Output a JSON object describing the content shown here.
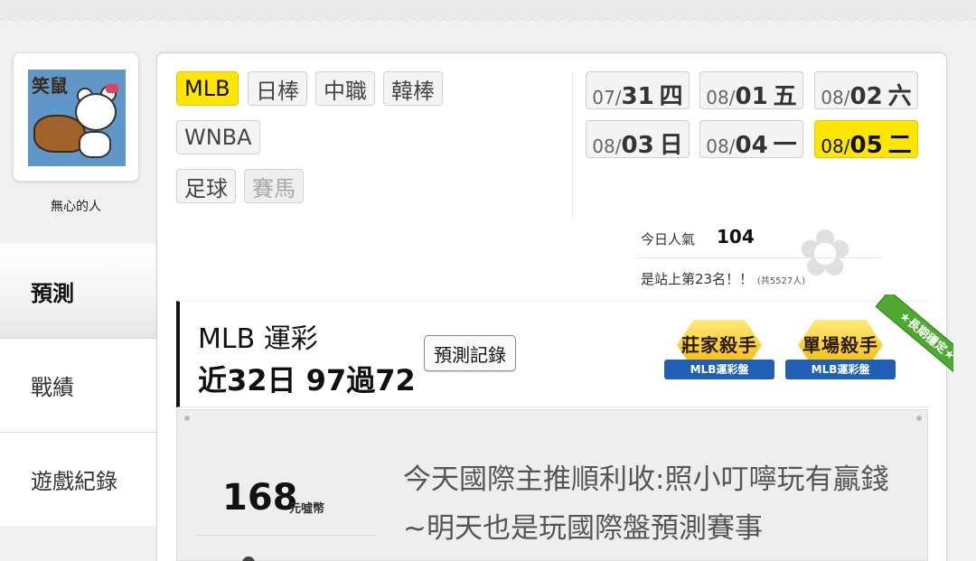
{
  "profile": {
    "avatar_caption": "笑鼠",
    "username": "無心的人"
  },
  "sidebar": {
    "items": [
      {
        "label": "預測",
        "active": true
      },
      {
        "label": "戰績",
        "active": false
      },
      {
        "label": "遊戲紀錄",
        "active": false
      }
    ]
  },
  "sports": [
    {
      "label": "MLB",
      "selected": true
    },
    {
      "label": "日棒",
      "selected": false
    },
    {
      "label": "中職",
      "selected": false
    },
    {
      "label": "韓棒",
      "selected": false
    },
    {
      "label": "WNBA",
      "selected": false
    },
    {
      "label": "足球",
      "selected": false
    },
    {
      "label": "賽馬",
      "selected": false,
      "disabled": true
    }
  ],
  "dates": [
    {
      "md": "07/",
      "d": "31",
      "wd": "四",
      "selected": false
    },
    {
      "md": "08/",
      "d": "01",
      "wd": "五",
      "selected": false
    },
    {
      "md": "08/",
      "d": "02",
      "wd": "六",
      "selected": false
    },
    {
      "md": "08/",
      "d": "03",
      "wd": "日",
      "selected": false
    },
    {
      "md": "08/",
      "d": "04",
      "wd": "一",
      "selected": false
    },
    {
      "md": "08/",
      "d": "05",
      "wd": "二",
      "selected": true
    }
  ],
  "popularity": {
    "label": "今日人氣",
    "count": "104",
    "rank_text": "是站上第23名！！",
    "rank_total": "(共5527人)"
  },
  "record": {
    "title": "MLB 運彩",
    "stats": "近32日 97過72",
    "button_label": "預測記錄",
    "badges": [
      {
        "title": "莊家殺手",
        "ribbon": "MLB運彩盤"
      },
      {
        "title": "單場殺手",
        "ribbon": "MLB運彩盤"
      }
    ],
    "corner_ribbon": "★長期穩定★"
  },
  "content": {
    "coins": "168",
    "coins_unit": "元噓幣",
    "message": "今天國際主推順利收:照小叮嚀玩有贏錢~明天也是玩國際盤預測賽事"
  },
  "colors": {
    "accent_yellow": "#ffe600",
    "badge_blue": "#1f5fb5",
    "ribbon_green": "#4caa2e"
  }
}
